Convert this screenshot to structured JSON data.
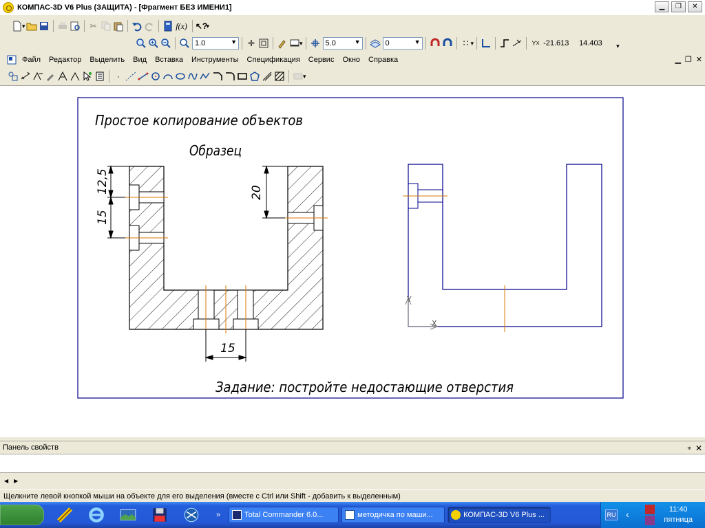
{
  "window": {
    "title": "КОМПАС-3D V6 Plus (ЗАЩИТА) - [Фрагмент БЕЗ ИМЕНИ1]",
    "min_icon": "minimize-icon",
    "max_icon": "maximize-icon",
    "close_icon": "close-icon"
  },
  "toolbar2": {
    "zoom_value": "1.0",
    "step_value": "5.0",
    "layer_value": "0",
    "coord_x": "-21.613",
    "coord_y": "14.403",
    "fx_label": "f(x)"
  },
  "menu": {
    "items": [
      "Файл",
      "Редактор",
      "Выделить",
      "Вид",
      "Вставка",
      "Инструменты",
      "Спецификация",
      "Сервис",
      "Окно",
      "Справка"
    ]
  },
  "drawing": {
    "title": "Простое копирование объектов",
    "sample_label": "Образец",
    "dim_12_5": "12,5",
    "dim_15_left": "15",
    "dim_20": "20",
    "dim_15_bottom": "15",
    "task_text": "Задание: постройте недостающие отверстия",
    "axis_x": "X",
    "axis_y": "Y",
    "colors": {
      "frame": "#00008b",
      "axis": "#d97a00",
      "dim": "#000000"
    }
  },
  "panel": {
    "title": "Панель свойств",
    "pin_icon": "pin-icon",
    "close_icon": "close-icon"
  },
  "status": {
    "text": "Щелкните левой кнопкой мыши на объекте для его выделения (вместе с Ctrl или Shift - добавить к выделенным)"
  },
  "taskbar": {
    "tasks": [
      {
        "label": "Total Commander 6.0...",
        "icon": "floppy-icon"
      },
      {
        "label": "методичка по маши...",
        "icon": "word-icon"
      },
      {
        "label": "КОМПАС-3D V6 Plus ...",
        "icon": "kompas-icon"
      }
    ],
    "lang": "RU",
    "time": "11:40",
    "day": "пятница"
  }
}
